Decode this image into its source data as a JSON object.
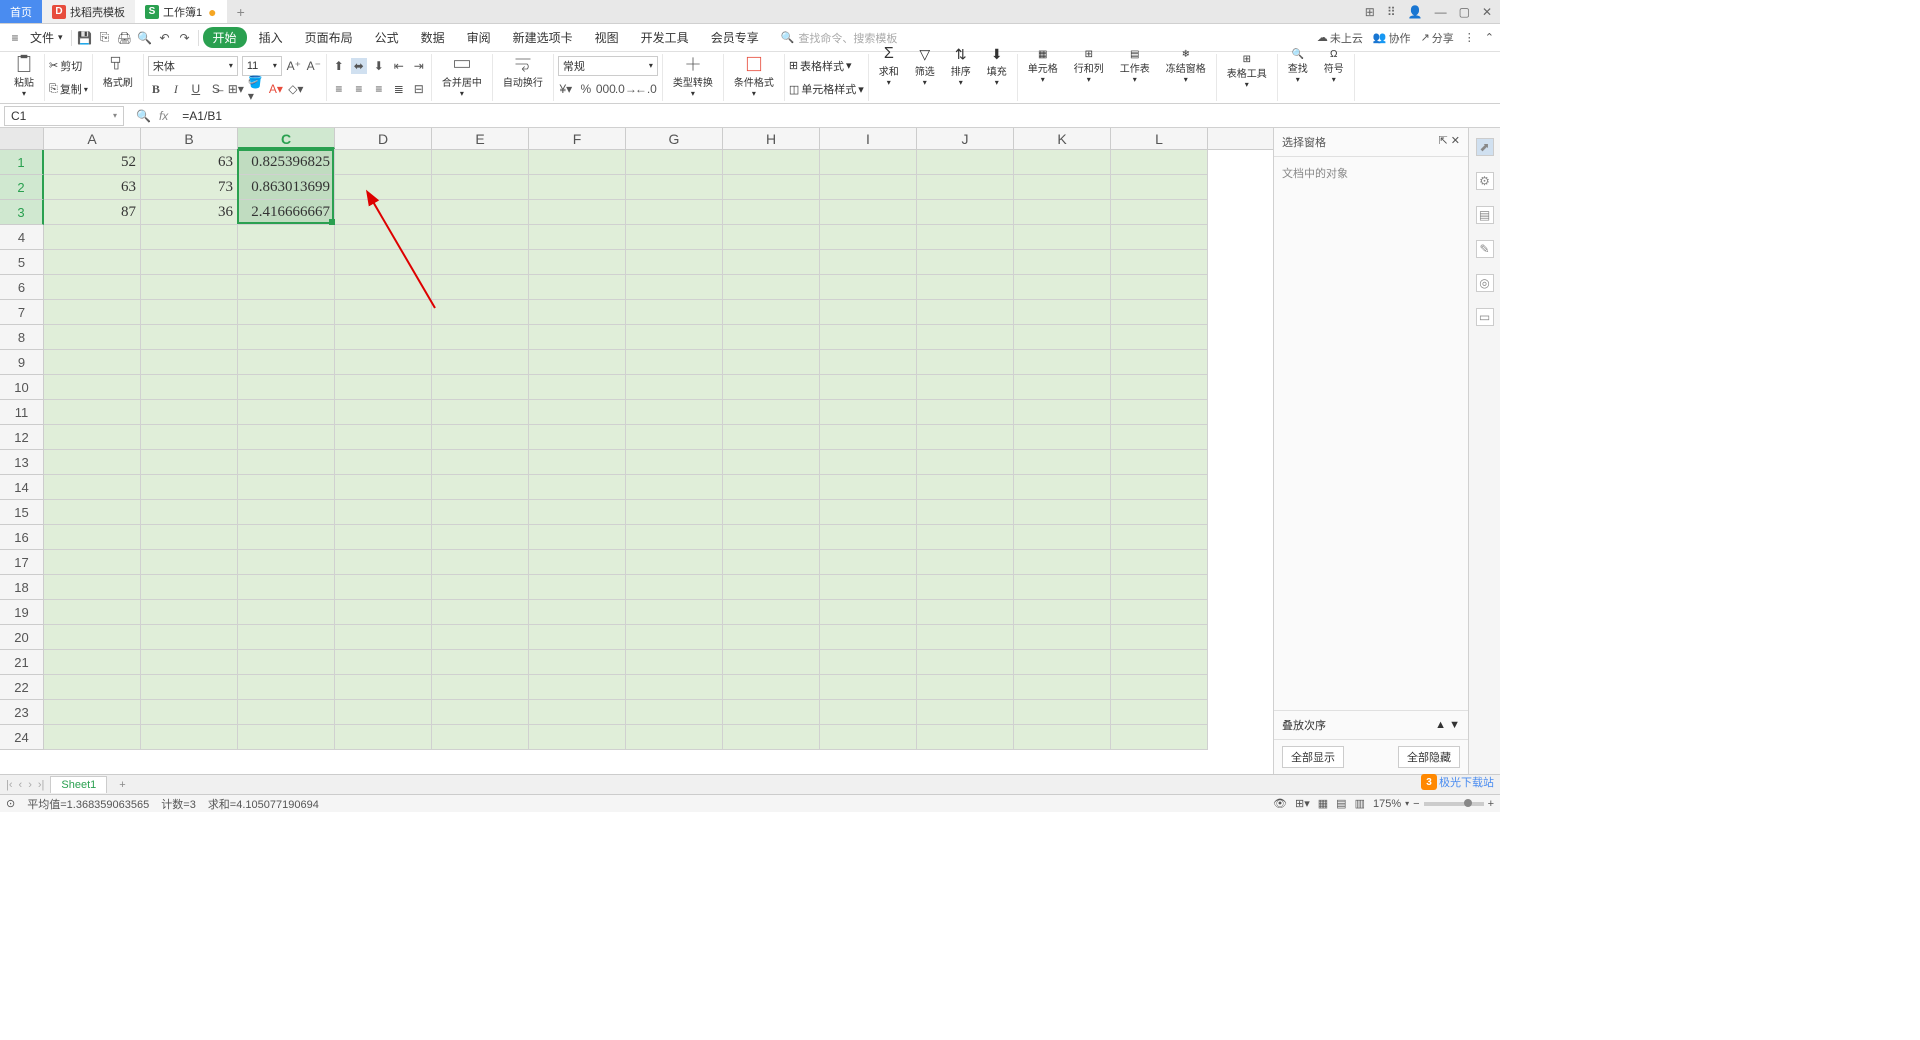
{
  "tabs": {
    "home": "首页",
    "template": "找稻壳模板",
    "workbook": "工作簿1",
    "modified": "●"
  },
  "menu": {
    "file": "文件",
    "tabs": [
      "开始",
      "插入",
      "页面布局",
      "公式",
      "数据",
      "审阅",
      "新建选项卡",
      "视图",
      "开发工具",
      "会员专享"
    ],
    "search_placeholder": "查找命令、搜索模板",
    "cloud": "未上云",
    "coop": "协作",
    "share": "分享"
  },
  "ribbon": {
    "paste": "粘贴",
    "cut": "剪切",
    "copy": "复制",
    "format_painter": "格式刷",
    "font": "宋体",
    "font_size": "11",
    "merge": "合并居中",
    "wrap": "自动换行",
    "number_format": "常规",
    "type_convert": "类型转换",
    "cond_format": "条件格式",
    "table_style": "表格样式",
    "cell_style": "单元格样式",
    "sum": "求和",
    "filter": "筛选",
    "sort": "排序",
    "fill": "填充",
    "cell": "单元格",
    "rowcol": "行和列",
    "worksheet": "工作表",
    "freeze": "冻结窗格",
    "table_tools": "表格工具",
    "find": "查找",
    "symbol": "符号"
  },
  "formula_bar": {
    "cell_ref": "C1",
    "formula": "=A1/B1"
  },
  "columns": [
    "A",
    "B",
    "C",
    "D",
    "E",
    "F",
    "G",
    "H",
    "I",
    "J",
    "K",
    "L"
  ],
  "row_count": 24,
  "selected_column_index": 2,
  "selected_rows": [
    0,
    1,
    2
  ],
  "cells": {
    "A1": "52",
    "B1": "63",
    "C1": "0.825396825",
    "A2": "63",
    "B2": "73",
    "C2": "0.863013699",
    "A3": "87",
    "B3": "36",
    "C3": "2.416666667"
  },
  "side_panel": {
    "title": "选择窗格",
    "content_label": "文档中的对象",
    "stack_order": "叠放次序",
    "show_all": "全部显示",
    "hide_all": "全部隐藏"
  },
  "sheet_tabs": {
    "sheet1": "Sheet1"
  },
  "status": {
    "avg_label": "平均值=",
    "avg": "1.368359063565",
    "count_label": "计数=",
    "count": "3",
    "sum_label": "求和=",
    "sum": "4.105077190694",
    "zoom": "175%"
  },
  "watermark": "极光下载站"
}
